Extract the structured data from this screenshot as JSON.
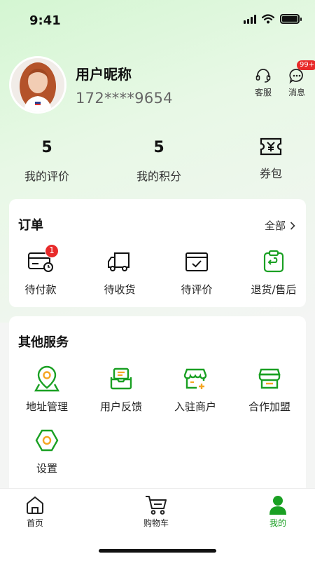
{
  "status_bar": {
    "time": "9:41"
  },
  "profile": {
    "nickname": "用户昵称",
    "phone": "172****9654"
  },
  "top_actions": {
    "service_label": "客服",
    "messages_label": "消息",
    "messages_badge": "99+"
  },
  "stats": [
    {
      "value": "5",
      "label": "我的评价"
    },
    {
      "value": "5",
      "label": "我的积分"
    },
    {
      "value": "",
      "label": "券包",
      "icon": "coupon-icon"
    }
  ],
  "orders": {
    "title": "订单",
    "view_all": "全部",
    "items": [
      {
        "label": "待付款",
        "icon": "pending-payment-icon",
        "badge": "1"
      },
      {
        "label": "待收货",
        "icon": "truck-icon"
      },
      {
        "label": "待评价",
        "icon": "review-icon"
      },
      {
        "label": "退货/售后",
        "icon": "return-icon"
      }
    ]
  },
  "services": {
    "title": "其他服务",
    "items": [
      {
        "label": "地址管理",
        "icon": "location-pin-icon"
      },
      {
        "label": "用户反馈",
        "icon": "feedback-icon"
      },
      {
        "label": "入驻商户",
        "icon": "merchant-icon"
      },
      {
        "label": "合作加盟",
        "icon": "store-icon"
      },
      {
        "label": "设置",
        "icon": "settings-icon"
      }
    ]
  },
  "tabbar": {
    "items": [
      {
        "label": "首页",
        "icon": "home-icon"
      },
      {
        "label": "购物车",
        "icon": "cart-icon"
      },
      {
        "label": "我的",
        "icon": "user-icon",
        "active": true
      }
    ]
  },
  "colors": {
    "accent_green": "#1aa023",
    "badge_red": "#e82a2a",
    "accent_orange": "#f5a623"
  }
}
